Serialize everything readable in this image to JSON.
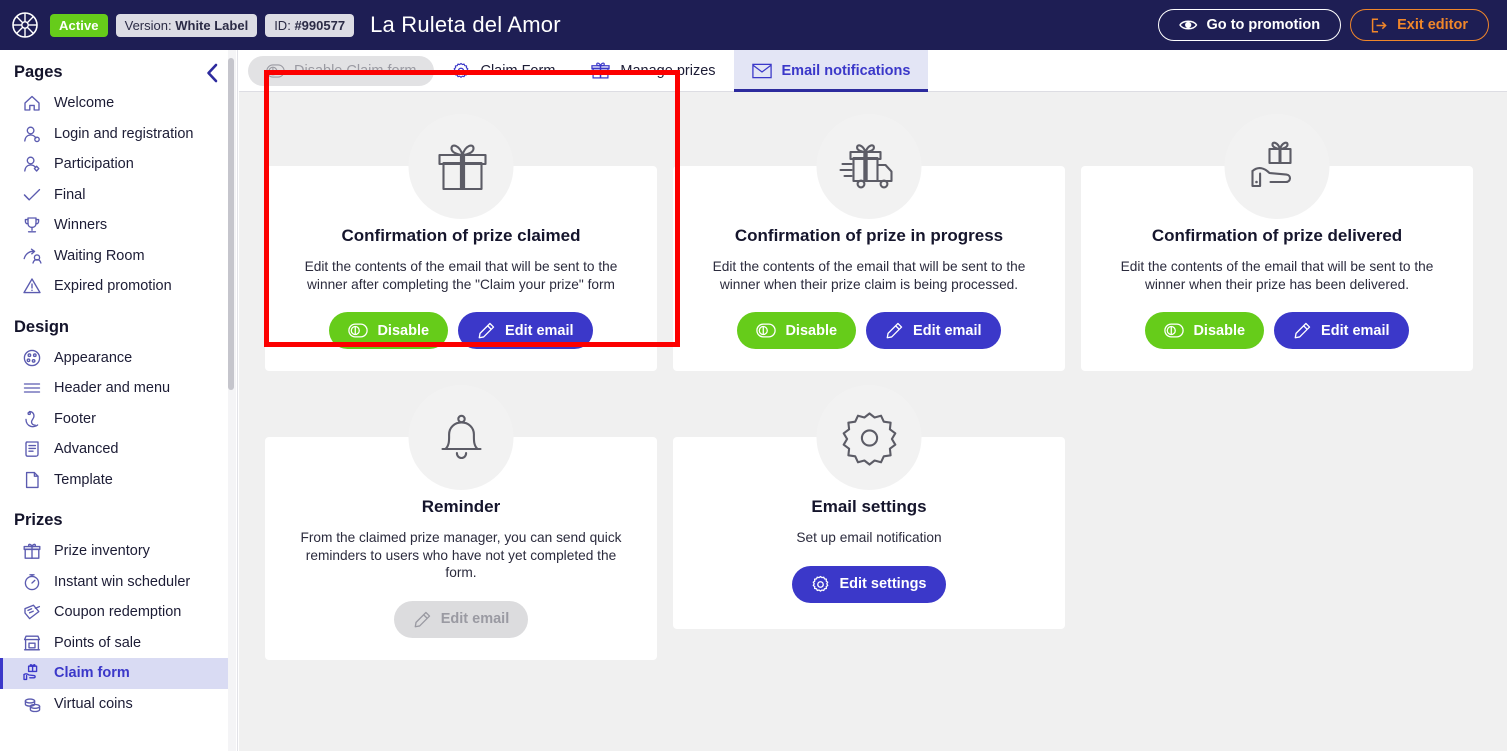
{
  "header": {
    "logo_icon": "wheel-logo-icon",
    "status_badge": "Active",
    "version_label": "Version:",
    "version_value": "White Label",
    "id_label": "ID:",
    "id_value": "#990577",
    "promotion_title": "La Ruleta del Amor",
    "go_to_promotion": "Go to promotion",
    "exit_editor": "Exit editor",
    "colors": {
      "bar_bg": "#1e1e54",
      "active_badge": "#66cc1a",
      "exit_accent": "#f0862a"
    }
  },
  "sidebar": {
    "sections": [
      {
        "title": "Pages",
        "items": [
          {
            "label": "Welcome",
            "icon": "home-icon",
            "active": false
          },
          {
            "label": "Login and registration",
            "icon": "user-login-icon",
            "active": false
          },
          {
            "label": "Participation",
            "icon": "user-participation-icon",
            "active": false
          },
          {
            "label": "Final",
            "icon": "check-icon",
            "active": false
          },
          {
            "label": "Winners",
            "icon": "trophy-icon",
            "active": false
          },
          {
            "label": "Waiting Room",
            "icon": "waiting-room-icon",
            "active": false
          },
          {
            "label": "Expired promotion",
            "icon": "warning-triangle-icon",
            "active": false
          }
        ]
      },
      {
        "title": "Design",
        "items": [
          {
            "label": "Appearance",
            "icon": "palette-icon",
            "active": false
          },
          {
            "label": "Header and menu",
            "icon": "menu-lines-icon",
            "active": false
          },
          {
            "label": "Footer",
            "icon": "footer-icon",
            "active": false
          },
          {
            "label": "Advanced",
            "icon": "scroll-document-icon",
            "active": false
          },
          {
            "label": "Template",
            "icon": "page-icon",
            "active": false
          }
        ]
      },
      {
        "title": "Prizes",
        "items": [
          {
            "label": "Prize inventory",
            "icon": "gift-icon",
            "active": false
          },
          {
            "label": "Instant win scheduler",
            "icon": "stopwatch-icon",
            "active": false
          },
          {
            "label": "Coupon redemption",
            "icon": "coupon-icon",
            "active": false
          },
          {
            "label": "Points of sale",
            "icon": "store-icon",
            "active": false
          },
          {
            "label": "Claim form",
            "icon": "hand-gift-icon",
            "active": true
          },
          {
            "label": "Virtual coins",
            "icon": "coins-icon",
            "active": false
          }
        ]
      }
    ],
    "collapse_icon": "chevron-left-icon"
  },
  "tabs": {
    "disable_pill": {
      "label": "Disable Claim form",
      "icon": "toggle-off-icon",
      "active": false
    },
    "items": [
      {
        "label": "Claim Form",
        "icon": "gear-icon",
        "active": false
      },
      {
        "label": "Manage prizes",
        "icon": "gift-icon",
        "active": false
      },
      {
        "label": "Email notifications",
        "icon": "envelope-icon",
        "active": true
      }
    ]
  },
  "cards": [
    {
      "id": "confirmation-of-prize-claimed",
      "icon": "gift-box-icon",
      "title": "Confirmation of prize claimed",
      "description": "Edit the contents of the email that will be sent to the winner after completing the \"Claim your prize\" form",
      "highlighted": true,
      "buttons": [
        {
          "label": "Disable",
          "icon": "toggle-off-icon",
          "style": "green"
        },
        {
          "label": "Edit email",
          "icon": "pencil-icon",
          "style": "blue"
        }
      ]
    },
    {
      "id": "confirmation-of-prize-in-progress",
      "icon": "gift-truck-icon",
      "title": "Confirmation of prize in progress",
      "description": "Edit the contents of the email that will be sent to the winner when their prize claim is being processed.",
      "highlighted": false,
      "buttons": [
        {
          "label": "Disable",
          "icon": "toggle-off-icon",
          "style": "green"
        },
        {
          "label": "Edit email",
          "icon": "pencil-icon",
          "style": "blue"
        }
      ]
    },
    {
      "id": "confirmation-of-prize-delivered",
      "icon": "gift-hand-icon",
      "title": "Confirmation of prize delivered",
      "description": "Edit the contents of the email that will be sent to the winner when their prize has been delivered.",
      "highlighted": false,
      "buttons": [
        {
          "label": "Disable",
          "icon": "toggle-off-icon",
          "style": "green"
        },
        {
          "label": "Edit email",
          "icon": "pencil-icon",
          "style": "blue"
        }
      ]
    },
    {
      "id": "reminder",
      "icon": "bell-icon",
      "title": "Reminder",
      "description": "From the claimed prize manager, you can send quick reminders to users who have not yet completed the form.",
      "highlighted": false,
      "buttons": [
        {
          "label": "Edit email",
          "icon": "pencil-icon",
          "style": "disabled"
        }
      ]
    },
    {
      "id": "email-settings",
      "icon": "gear-icon",
      "title": "Email settings",
      "description": "Set up email notification",
      "highlighted": false,
      "buttons": [
        {
          "label": "Edit settings",
          "icon": "gear-icon",
          "style": "blue"
        }
      ]
    }
  ],
  "theme": {
    "primary_blue": "#3b38c9",
    "green": "#66cc1a",
    "highlight_red": "#fc0000",
    "page_bg": "#f0f0f0",
    "active_tab_bg": "#e3e5f5",
    "active_sidebar_bg": "#d9dbf3"
  }
}
